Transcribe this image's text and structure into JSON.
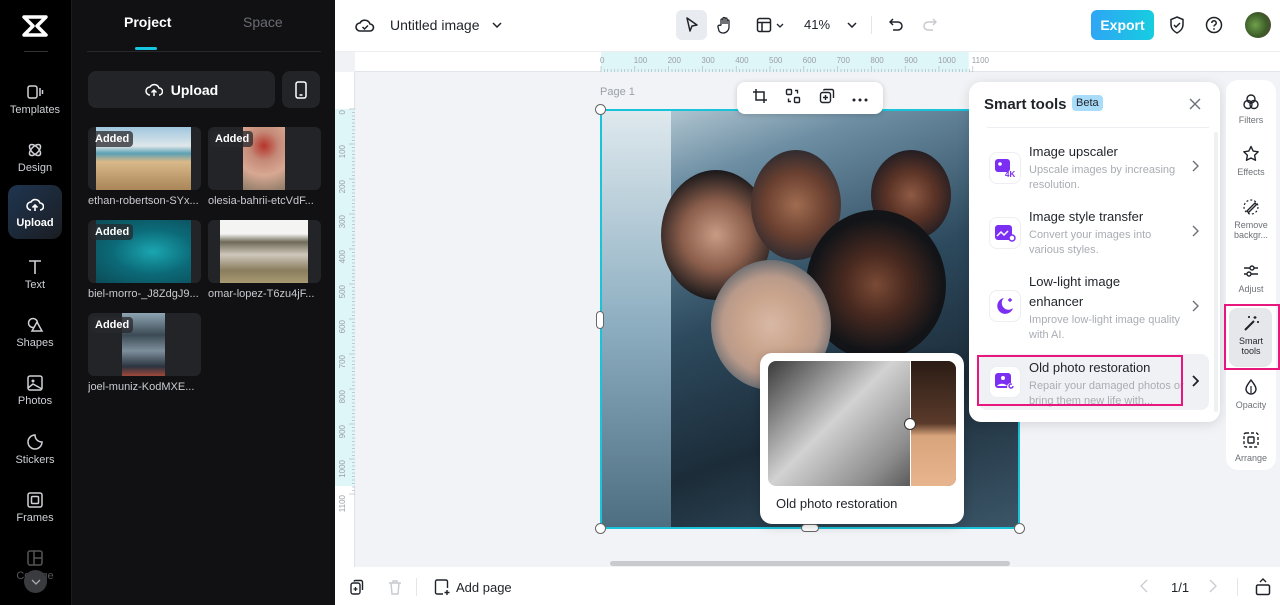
{
  "left_rail": {
    "items": [
      {
        "label": "Templates",
        "icon": "templates-icon"
      },
      {
        "label": "Design",
        "icon": "design-icon"
      },
      {
        "label": "Upload",
        "icon": "upload-cloud-icon",
        "active": true
      },
      {
        "label": "Text",
        "icon": "text-icon"
      },
      {
        "label": "Shapes",
        "icon": "shapes-icon"
      },
      {
        "label": "Photos",
        "icon": "photos-icon"
      },
      {
        "label": "Stickers",
        "icon": "stickers-icon"
      },
      {
        "label": "Frames",
        "icon": "frames-icon"
      },
      {
        "label": "Collage",
        "icon": "collage-icon"
      }
    ]
  },
  "panel": {
    "tabs": [
      {
        "label": "Project",
        "active": true
      },
      {
        "label": "Space"
      }
    ],
    "upload_label": "Upload",
    "badge_label": "Added",
    "files": [
      {
        "name": "ethan-robertson-SYx..."
      },
      {
        "name": "olesia-bahrii-etcVdF..."
      },
      {
        "name": "biel-morro-_J8ZdgJ9..."
      },
      {
        "name": "omar-lopez-T6zu4jF..."
      },
      {
        "name": "joel-muniz-KodMXE..."
      }
    ]
  },
  "topbar": {
    "title": "Untitled image",
    "zoom": "41%",
    "export_label": "Export",
    "accent": "#16c5e0"
  },
  "ruler": {
    "h_ticks": [
      "0",
      "100",
      "200",
      "300",
      "400",
      "500",
      "600",
      "700",
      "800",
      "900",
      "1000",
      "1100"
    ],
    "v_ticks": [
      "0",
      "100",
      "200",
      "300",
      "400",
      "500",
      "600",
      "700",
      "800",
      "900",
      "1000",
      "1100"
    ]
  },
  "canvas": {
    "page_label": "Page 1",
    "tooltip_label": "Old photo restoration"
  },
  "smart_tools": {
    "title": "Smart tools",
    "beta": "Beta",
    "items": [
      {
        "name": "Image upscaler",
        "desc": "Upscale images by increasing resolution.",
        "icon": "upscale-4k-icon"
      },
      {
        "name": "Image style transfer",
        "desc": "Convert your images into various styles.",
        "icon": "style-transfer-icon"
      },
      {
        "name": "Low-light image enhancer",
        "desc": "Improve low-light image quality with AI.",
        "icon": "moon-sparkle-icon"
      },
      {
        "name": "Old photo restoration",
        "desc": "Repair your damaged photos or bring them new life with...",
        "icon": "photo-restore-icon",
        "highlighted": true
      }
    ]
  },
  "right_rail": {
    "items": [
      {
        "label": "Filters"
      },
      {
        "label": "Effects"
      },
      {
        "label": "Remove backgr..."
      },
      {
        "label": "Adjust"
      },
      {
        "label": "Smart tools",
        "active": true
      },
      {
        "label": "Opacity"
      },
      {
        "label": "Arrange"
      }
    ]
  },
  "bottombar": {
    "add_page_label": "Add page",
    "page_counter": "1/1"
  }
}
